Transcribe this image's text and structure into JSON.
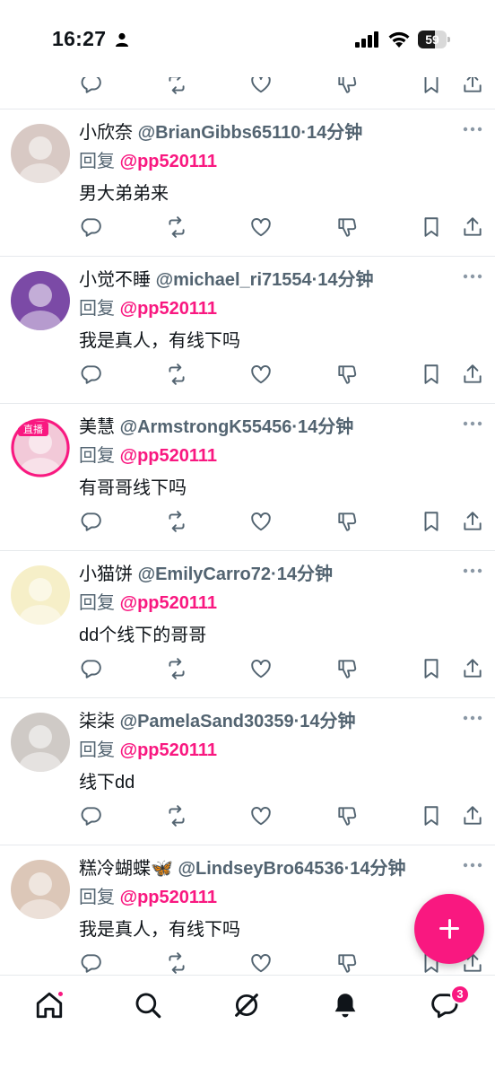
{
  "status_bar": {
    "time": "16:27",
    "battery": "59",
    "battery_level": 0.59
  },
  "colors": {
    "accent": "#f91880",
    "text_primary": "#0f1419",
    "text_secondary": "#536471",
    "divider": "#e6e9ec"
  },
  "tweets": [
    {
      "display_name": "小欣奈",
      "handle": "@BrianGibbs65110",
      "dot": "·",
      "time": "14分钟",
      "reply_prefix": "回复",
      "reply_to": "@pp520111",
      "text": "男大弟弟来",
      "avatar_color": "#d8c9c4"
    },
    {
      "display_name": "小觉不睡",
      "handle": "@michael_ri71554",
      "dot": "·",
      "time": "14分钟",
      "reply_prefix": "回复",
      "reply_to": "@pp520111",
      "text": "我是真人，有线下吗",
      "avatar_color": "#7b4aa6"
    },
    {
      "display_name": "美慧",
      "handle": "@ArmstrongK55456",
      "dot": "·",
      "time": "14分钟",
      "reply_prefix": "回复",
      "reply_to": "@pp520111",
      "text": "有哥哥线下吗",
      "avatar_color": "#f2c9d8",
      "avatar_label": "直播"
    },
    {
      "display_name": "小猫饼",
      "handle": "@EmilyCarro72",
      "dot": "·",
      "time": "14分钟",
      "reply_prefix": "回复",
      "reply_to": "@pp520111",
      "text": "dd个线下的哥哥",
      "avatar_color": "#f6efc8"
    },
    {
      "display_name": "柒柒",
      "handle": "@PamelaSand30359",
      "dot": "·",
      "time": "14分钟",
      "reply_prefix": "回复",
      "reply_to": "@pp520111",
      "text": "线下dd",
      "avatar_color": "#cfcac6"
    },
    {
      "display_name": "糕冷蝴蝶🦋",
      "handle": "@LindseyBro64536",
      "dot": "·",
      "time": "14分钟",
      "reply_prefix": "回复",
      "reply_to": "@pp520111",
      "text": "我是真人，有线下吗",
      "avatar_color": "#dcc7b8"
    }
  ],
  "action_icons": [
    "reply-icon",
    "retweet-icon",
    "like-icon",
    "dislike-icon",
    "bookmark-icon",
    "share-icon"
  ],
  "bottom_nav": {
    "items": [
      "home-icon",
      "search-icon",
      "grok-icon",
      "notifications-icon",
      "messages-icon"
    ],
    "messages_badge": "3"
  },
  "fab": {
    "icon": "plus-icon"
  }
}
